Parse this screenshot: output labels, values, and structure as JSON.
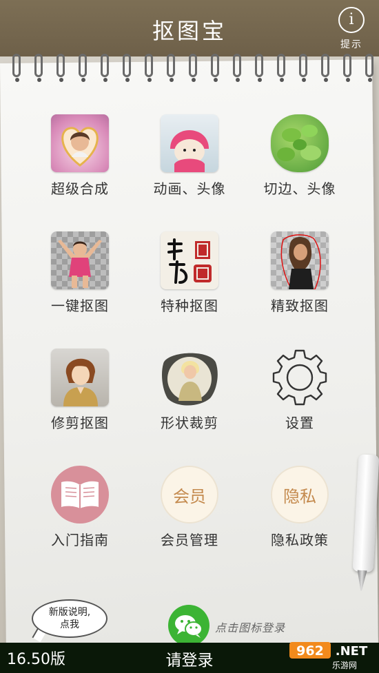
{
  "header": {
    "title": "抠图宝",
    "info_icon_glyph": "i",
    "info_label": "提示"
  },
  "grid": {
    "items": [
      {
        "label": "超级合成",
        "icon": "heart-portrait-icon"
      },
      {
        "label": "动画、头像",
        "icon": "cartoon-character-icon"
      },
      {
        "label": "切边、头像",
        "icon": "leaves-icon"
      },
      {
        "label": "一键抠图",
        "icon": "child-cutout-icon"
      },
      {
        "label": "特种抠图",
        "icon": "calligraphy-seal-icon"
      },
      {
        "label": "精致抠图",
        "icon": "woman-cutout-icon"
      },
      {
        "label": "修剪抠图",
        "icon": "anime-character-icon"
      },
      {
        "label": "形状裁剪",
        "icon": "shape-crop-portrait-icon"
      },
      {
        "label": "设置",
        "icon": "gear-icon"
      },
      {
        "label": "入门指南",
        "icon": "open-book-icon"
      },
      {
        "label": "会员管理",
        "icon": "vip-icon",
        "badge": "会员"
      },
      {
        "label": "隐私政策",
        "icon": "privacy-icon",
        "badge": "隐私"
      }
    ]
  },
  "footer": {
    "bubble_text_line1": "新版说明,",
    "bubble_text_line2": "点我",
    "wechat_hint": "点击图标登录",
    "version": "16.50版",
    "login": "请登录",
    "site_logo_text": "962.NET",
    "site_logo_sub": "乐游网"
  },
  "colors": {
    "header_bg": "#7d6f55",
    "bottom_bar_bg": "#0a1808",
    "wechat_green": "#3cb434",
    "badge_text": "#c48a4e",
    "book_bg": "#d8909a"
  }
}
